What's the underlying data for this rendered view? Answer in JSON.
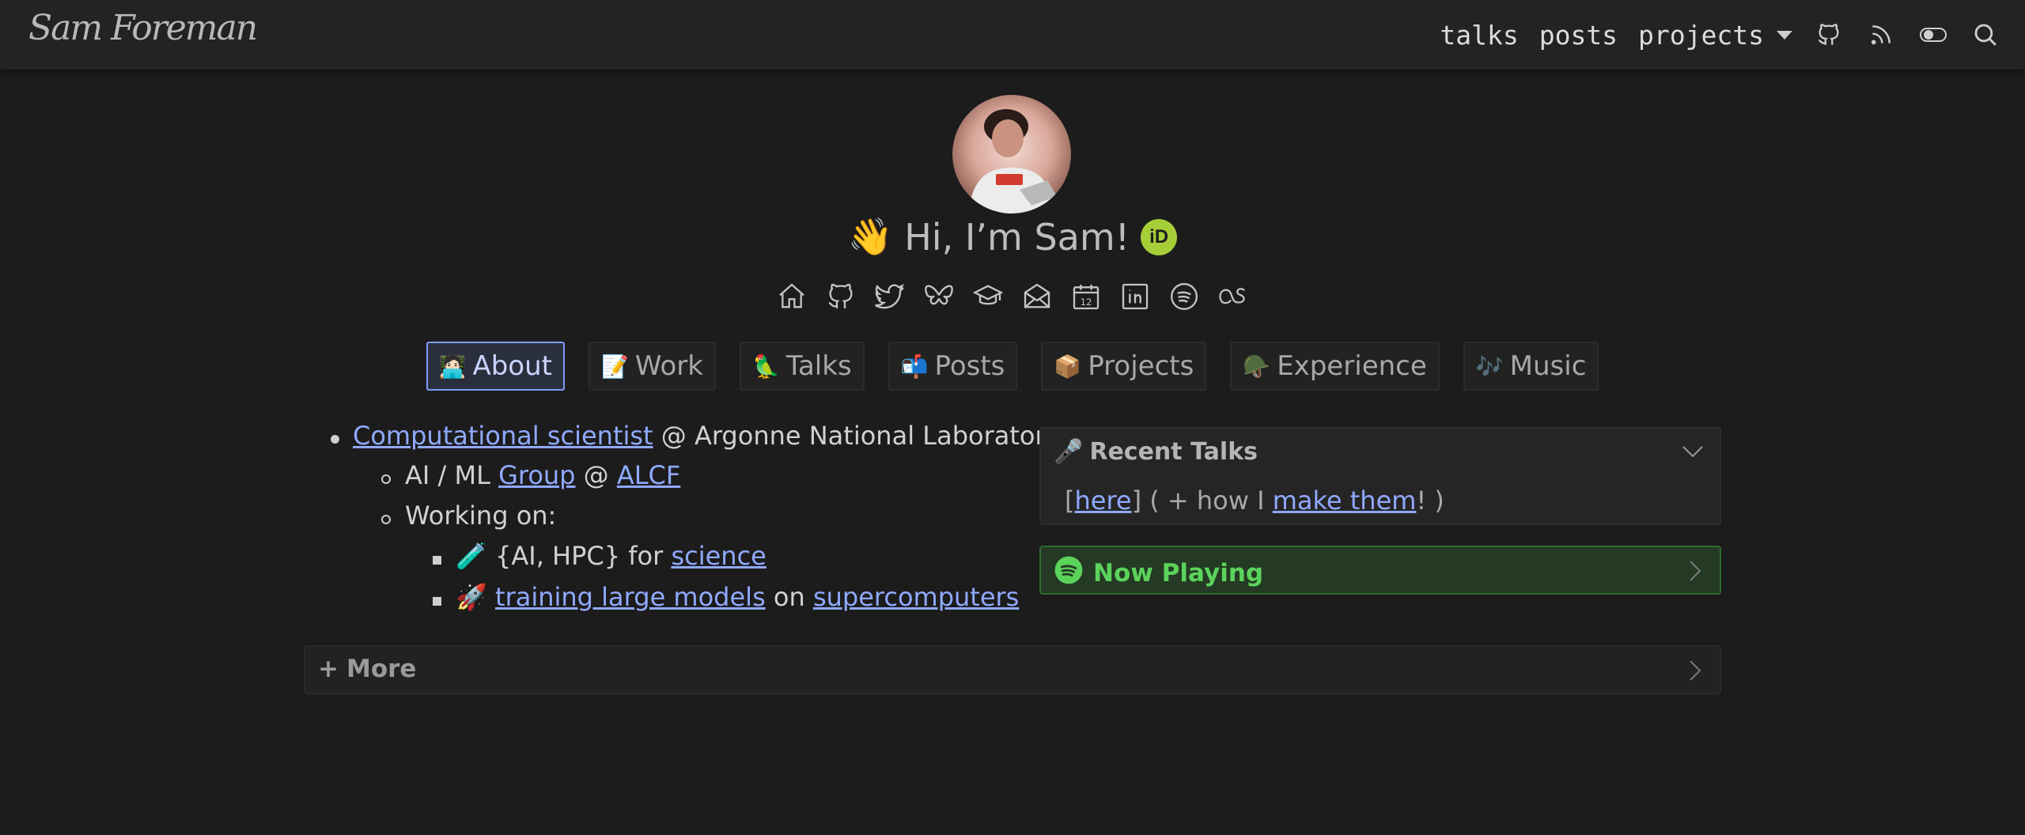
{
  "navbar": {
    "brand": "Sam Foreman",
    "links": {
      "talks": "talks",
      "posts": "posts",
      "projects": "projects"
    },
    "icons": [
      "github-icon",
      "rss-icon",
      "theme-toggle-icon",
      "search-icon"
    ]
  },
  "hero": {
    "wave": "👋",
    "title": "Hi, I’m Sam!",
    "orcid": "iD"
  },
  "social": [
    "home-icon",
    "github-icon",
    "twitter-icon",
    "bluesky-icon",
    "scholar-icon",
    "email-icon",
    "calendar-icon",
    "linkedin-icon",
    "spotify-icon",
    "lastfm-icon"
  ],
  "calendar_day": "12",
  "tabs": [
    {
      "emoji": "🧑🏻‍💻",
      "label": "About"
    },
    {
      "emoji": "📝",
      "label": "Work"
    },
    {
      "emoji": "🦜",
      "label": "Talks"
    },
    {
      "emoji": "📬",
      "label": "Posts"
    },
    {
      "emoji": "📦",
      "label": "Projects"
    },
    {
      "emoji": "🪖",
      "label": "Experience"
    },
    {
      "emoji": "🎶",
      "label": "Music"
    }
  ],
  "about": {
    "item1": {
      "link": "Computational scientist",
      "rest": " @ Argonne National Laboratory"
    },
    "item2": {
      "pre": "AI / ML ",
      "link1": "Group",
      "mid": " @ ",
      "link2": "ALCF"
    },
    "item3": {
      "text": "Working on:"
    },
    "item4": {
      "emoji": "🧪",
      "pre": " {AI, HPC} for ",
      "link": "science"
    },
    "item5": {
      "emoji": "🚀",
      "link1": "training large models",
      "mid": " on ",
      "link2": "supercomputers"
    }
  },
  "recent_talks": {
    "emoji": "🎤",
    "title": "Recent Talks",
    "open": "[",
    "link1": "here",
    "mid": "] ( + how I ",
    "link2": "make them",
    "close": "! )"
  },
  "now_playing": {
    "title": "Now Playing"
  },
  "more": {
    "plus": "+",
    "title": "More"
  }
}
